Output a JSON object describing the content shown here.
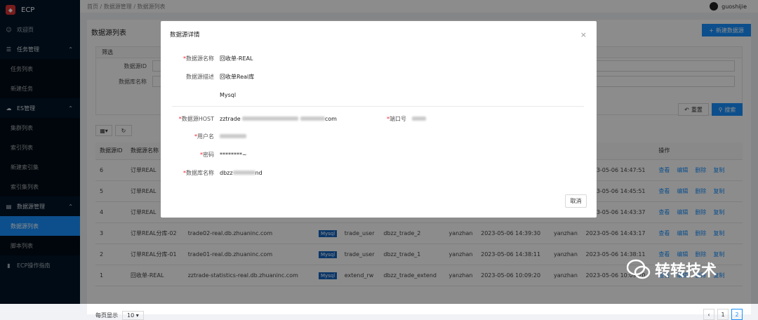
{
  "app": {
    "name": "ECP"
  },
  "sidebar": {
    "items": [
      {
        "label": "欢迎页",
        "type": "item",
        "icon": "smile-icon"
      },
      {
        "label": "任务管理",
        "type": "group",
        "icon": "list-icon"
      },
      {
        "label": "任务列表",
        "type": "sub"
      },
      {
        "label": "新建任务",
        "type": "sub"
      },
      {
        "label": "ES管理",
        "type": "group",
        "icon": "cloud-icon"
      },
      {
        "label": "集群列表",
        "type": "sub"
      },
      {
        "label": "索引列表",
        "type": "sub"
      },
      {
        "label": "新建索引集",
        "type": "sub"
      },
      {
        "label": "索引集列表",
        "type": "sub"
      },
      {
        "label": "数据源管理",
        "type": "group",
        "icon": "database-icon"
      },
      {
        "label": "数据源列表",
        "type": "sub",
        "active": true
      },
      {
        "label": "脚本列表",
        "type": "sub"
      },
      {
        "label": "ECP操作指南",
        "type": "item",
        "icon": "book-icon"
      }
    ]
  },
  "topbar": {
    "breadcrumb": "首页 / 数据源管理 / 数据源列表",
    "username": "guoshijie"
  },
  "page": {
    "title": "数据源列表",
    "new_button": "新建数据源",
    "filter_title": "筛选",
    "filter_id_label": "数据源ID",
    "filter_db_label": "数据库名称",
    "reset": "重置",
    "search": "搜索"
  },
  "table": {
    "headers": [
      "数据源ID",
      "数据源名称",
      "",
      "",
      "",
      "",
      "",
      "",
      "",
      "",
      "操作"
    ],
    "ops": [
      "查看",
      "编辑",
      "删除",
      "复制"
    ],
    "rows": [
      {
        "id": "6",
        "name": "订单REAL",
        "host": "",
        "type": "",
        "user": "",
        "db": "",
        "creator": "",
        "ctime": "",
        "updater": "",
        "utime": "2023-05-06 14:47:51"
      },
      {
        "id": "5",
        "name": "订单REAL",
        "host": "",
        "type": "",
        "user": "",
        "db": "",
        "creator": "",
        "ctime": "",
        "updater": "",
        "utime": "2023-05-06 14:45:51"
      },
      {
        "id": "4",
        "name": "订单REAL",
        "host": "",
        "type": "",
        "user": "",
        "db": "",
        "creator": "",
        "ctime": "",
        "updater": "",
        "utime": "2023-05-06 14:43:37"
      },
      {
        "id": "3",
        "name": "订单REAL分库-02",
        "host": "trade02-real.db.zhuaninc.com",
        "type": "Mysql",
        "user": "trade_user",
        "db": "dbzz_trade_2",
        "creator": "yanzhan",
        "ctime": "2023-05-06 14:39:30",
        "updater": "yanzhan",
        "utime": "2023-05-06 14:43:17"
      },
      {
        "id": "2",
        "name": "订单REAL分库-01",
        "host": "trade01-real.db.zhuaninc.com",
        "type": "Mysql",
        "user": "trade_user",
        "db": "dbzz_trade_1",
        "creator": "yanzhan",
        "ctime": "2023-05-06 14:38:11",
        "updater": "yanzhan",
        "utime": "2023-05-06 14:38:11"
      },
      {
        "id": "1",
        "name": "回收单-REAL",
        "host": "zztrade-statistics-real.db.zhuaninc.com",
        "type": "Mysql",
        "user": "extend_rw",
        "db": "dbzz_trade_extend",
        "creator": "yanzhan",
        "ctime": "2023-05-06 10:09:20",
        "updater": "yanzhan",
        "utime": "2023-05-06 10:09:20"
      }
    ]
  },
  "pager": {
    "label": "每页显示",
    "size": "10",
    "pages": [
      "1",
      "2"
    ]
  },
  "modal": {
    "title": "数据源详情",
    "name_label": "数据源名称",
    "name_value": "回收单-REAL",
    "desc_label": "数据源描述",
    "desc_value": "回收单Real库",
    "type_value": "Mysql",
    "host_label": "数据源HOST",
    "host_prefix": "zztrade",
    "host_suffix": "com",
    "port_label": "端口号",
    "user_label": "用户名",
    "pwd_label": "密码",
    "pwd_value": "********~",
    "db_label": "数据库名称",
    "db_prefix": "dbzz",
    "db_suffix": "nd",
    "cancel": "取消"
  },
  "watermark": {
    "text": "转转技术"
  }
}
